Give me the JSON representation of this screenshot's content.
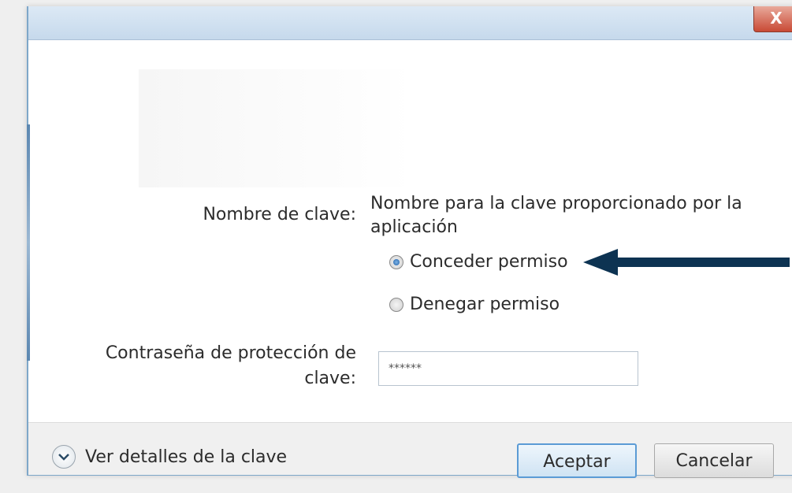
{
  "titlebar": {
    "close_label": "X"
  },
  "form": {
    "key_name_label": "Nombre de clave:",
    "key_name_value": "Nombre para la clave proporcionado por la aplicación",
    "radio_options": [
      {
        "label": "Conceder permiso",
        "checked": true
      },
      {
        "label": "Denegar permiso",
        "checked": false
      }
    ],
    "password_label_line1": "Contraseña de protección de",
    "password_label_line2": "clave:",
    "password_value": "******"
  },
  "footer": {
    "details_label": "Ver detalles de la clave",
    "ok_label": "Aceptar",
    "cancel_label": "Cancelar"
  },
  "annotation": {
    "arrow_color": "#0d3352"
  }
}
